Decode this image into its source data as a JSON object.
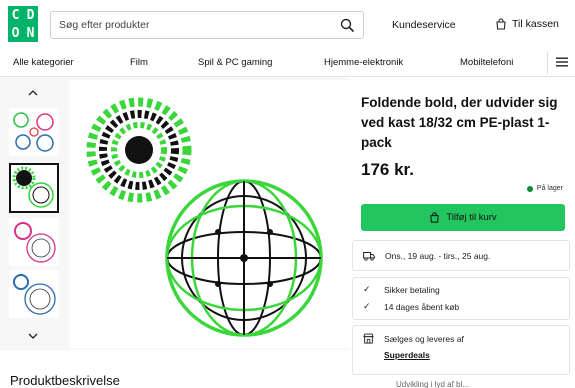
{
  "logo": {
    "letters": [
      "C",
      "D",
      "O",
      "N"
    ]
  },
  "search": {
    "placeholder": "Søg efter produkter",
    "icon": "search-icon"
  },
  "header": {
    "customer_service": "Kundeservice",
    "cart_label": "Til kassen"
  },
  "nav": {
    "items": [
      "Alle kategorier",
      "Film",
      "Spil & PC gaming",
      "Hjemme-elektronik",
      "Mobiltelefoni"
    ]
  },
  "product": {
    "title": "Foldende bold, der udvider sig ved kast 18/32 cm PE-plast 1-pack",
    "price": "176 kr.",
    "stock": "På lager",
    "buy_label": "Tilføj til kurv"
  },
  "delivery": {
    "text": "Ons., 19 aug. - tirs., 25 aug."
  },
  "benefits": [
    "Sikker betaling",
    "14 dages åbent køb"
  ],
  "seller": {
    "text": "Sælges og leveres af",
    "name": "Superdeals"
  },
  "description": {
    "heading": "Produktbeskrivelse"
  },
  "cutoff_text": "Udvikling i lyd af bl...",
  "colors": {
    "brand": "#00b36b",
    "buy": "#22c55e",
    "stock": "#0a8a3a"
  }
}
